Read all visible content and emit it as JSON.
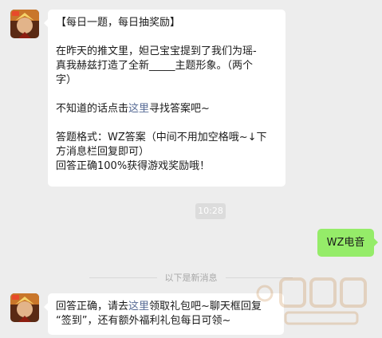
{
  "messages": [
    {
      "sender": "bot",
      "lines": [
        [
          {
            "text": "【每日一题，每日抽奖励】"
          }
        ],
        [],
        [
          {
            "text": "在昨天的推文里，妲己宝宝提到了我们为瑶-"
          }
        ],
        [
          {
            "text": "真我赫兹打造了全新_____主题形象。（两个"
          }
        ],
        [
          {
            "text": "字）"
          }
        ],
        [],
        [
          {
            "text": "不知道的话点击"
          },
          {
            "text": "这里",
            "link": true
          },
          {
            "text": "寻找答案吧~"
          }
        ],
        [],
        [
          {
            "text": "答题格式：WZ答案（中间不用加空格哦~↓下"
          }
        ],
        [
          {
            "text": "方消息栏回复即可）"
          }
        ],
        [
          {
            "text": "回答正确100%获得游戏奖励哦！"
          }
        ]
      ]
    },
    {
      "sender": "bot",
      "lines": [
        [
          {
            "text": "回答正确，请去"
          },
          {
            "text": "这里",
            "link": true
          },
          {
            "text": "领取礼包吧~聊天框回复"
          }
        ],
        [
          {
            "text": "“签到”，还有额外福利礼包每日可领~"
          }
        ]
      ]
    }
  ],
  "timestamp": "10:28",
  "outgoing": {
    "text": "WZ电音"
  },
  "divider": {
    "label": "以下是新消息"
  },
  "colors": {
    "background": "#ededed",
    "bubble_in": "#ffffff",
    "bubble_out": "#95ec69",
    "link": "#576b95"
  },
  "icons": {
    "bot_avatar": "game-hero-avatar-icon",
    "watermark": "watermark-logo"
  }
}
